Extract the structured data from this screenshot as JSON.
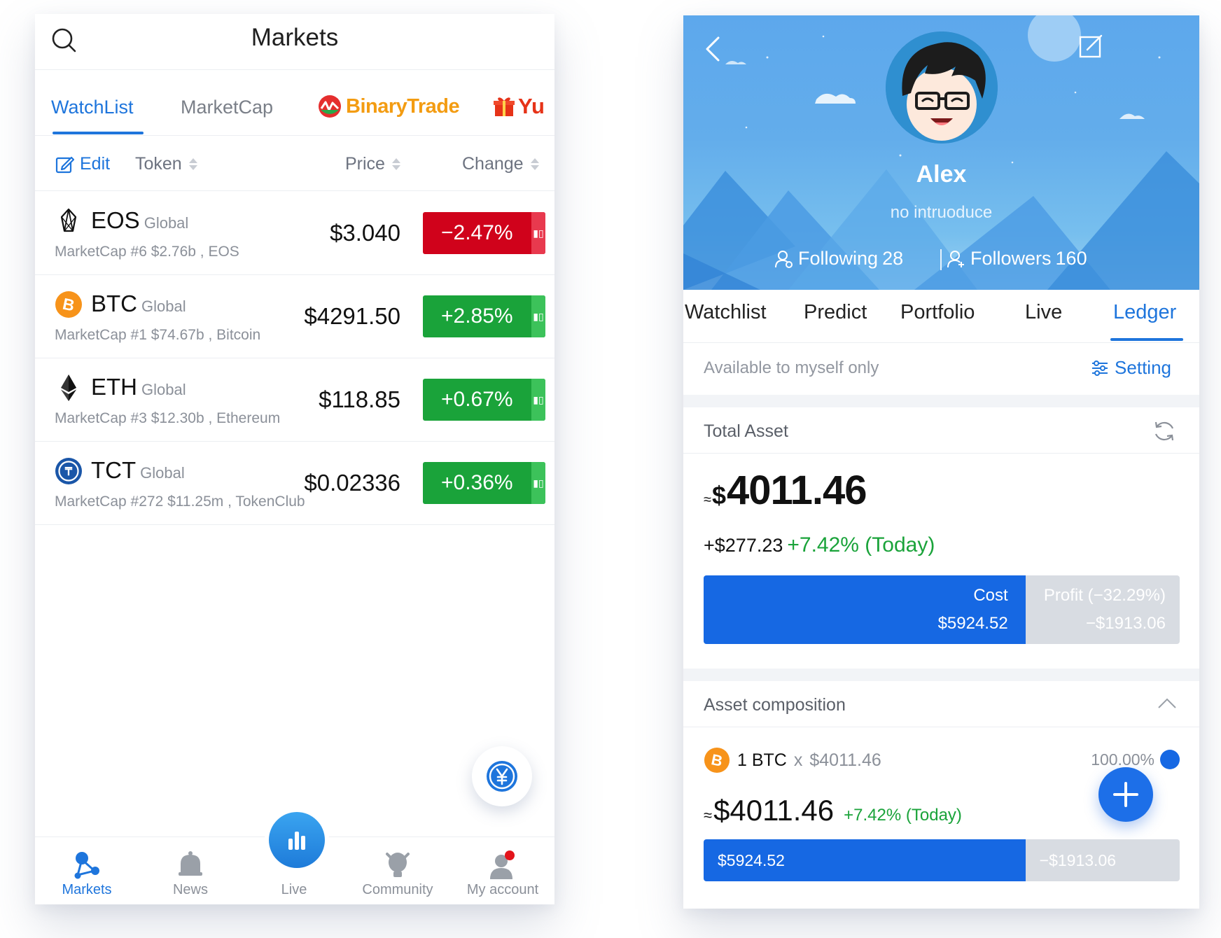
{
  "markets": {
    "title": "Markets",
    "tabs": [
      {
        "label": "WatchList",
        "active": true
      },
      {
        "label": "MarketCap",
        "active": false
      },
      {
        "label": "BinaryTrade",
        "active": false
      },
      {
        "label": "Yu",
        "active": false
      }
    ],
    "columns": {
      "edit": "Edit",
      "token": "Token",
      "price": "Price",
      "change": "Change"
    },
    "rows": [
      {
        "symbol": "EOS",
        "region": "Global",
        "sub": "MarketCap #6 $2.76b , EOS",
        "price": "$3.040",
        "change": "−2.47%",
        "direction": "down",
        "icon": "eos-icon"
      },
      {
        "symbol": "BTC",
        "region": "Global",
        "sub": "MarketCap #1 $74.67b , Bitcoin",
        "price": "$4291.50",
        "change": "+2.85%",
        "direction": "up",
        "icon": "btc-icon"
      },
      {
        "symbol": "ETH",
        "region": "Global",
        "sub": "MarketCap #3 $12.30b , Ethereum",
        "price": "$118.85",
        "change": "+0.67%",
        "direction": "up",
        "icon": "eth-icon"
      },
      {
        "symbol": "TCT",
        "region": "Global",
        "sub": "MarketCap #272 $11.25m , TokenClub",
        "price": "$0.02336",
        "change": "+0.36%",
        "direction": "up",
        "icon": "tct-icon"
      }
    ],
    "nav": [
      {
        "label": "Markets",
        "icon": "markets-icon",
        "active": true
      },
      {
        "label": "News",
        "icon": "news-icon",
        "active": false
      },
      {
        "label": "Live",
        "icon": "live-icon",
        "active": false
      },
      {
        "label": "Community",
        "icon": "community-icon",
        "active": false
      },
      {
        "label": "My account",
        "icon": "account-icon",
        "active": false
      }
    ],
    "colors": {
      "accent": "#1e75dc",
      "down": "#d0021b",
      "up": "#1aa33a"
    }
  },
  "profile": {
    "name": "Alex",
    "intro": "no intruoduce",
    "following_label": "Following",
    "following_count": "28",
    "followers_label": "Followers",
    "followers_count": "160",
    "tabs": [
      {
        "label": "Watchlist",
        "active": false
      },
      {
        "label": "Predict",
        "active": false
      },
      {
        "label": "Portfolio",
        "active": false
      },
      {
        "label": "Live",
        "active": false
      },
      {
        "label": "Ledger",
        "active": true
      }
    ],
    "privacy": "Available to myself only",
    "setting": "Setting",
    "total_asset": {
      "label": "Total Asset",
      "approx": "≈",
      "currency": "$",
      "value": "4011.46",
      "change_abs": "+$277.23",
      "change_pct": "+7.42% (Today)",
      "cost_label": "Cost",
      "cost_value": "$5924.52",
      "profit_label": "Profit (−32.29%)",
      "profit_value": "−$1913.06",
      "cost_share": 0.676
    },
    "composition": {
      "label": "Asset composition",
      "holding_qty": "1 BTC",
      "holding_x": "x",
      "holding_price": "$4011.46",
      "holding_pct": "100.00%",
      "value_approx": "≈",
      "value": "$4011.46",
      "value_change": "+7.42% (Today)",
      "cost_value": "$5924.52",
      "profit_value": "−$1913.06",
      "cost_share": 0.676
    }
  }
}
